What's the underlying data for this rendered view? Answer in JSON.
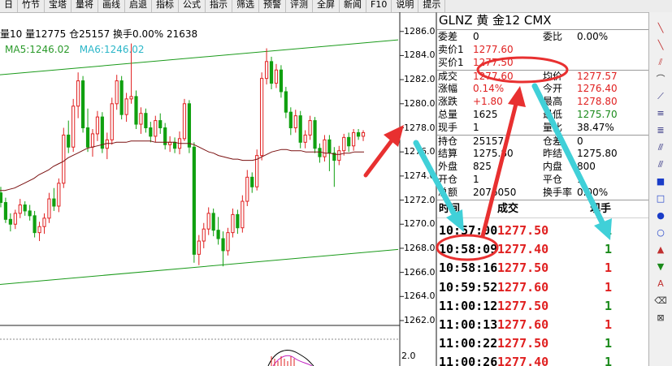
{
  "menubar": {
    "items": [
      "日",
      "竹节",
      "宝塔",
      "量将",
      "画线",
      "启退",
      "指标",
      "公式",
      "指示",
      "筛选",
      "预警",
      "评测",
      "全屏",
      "新闻",
      "F10",
      "说明",
      "提示"
    ]
  },
  "chart": {
    "info": "量10 量12775 仓25157 换手0.00% 21638",
    "ma5": "MA5:1246.02",
    "ma6": "MA6:1246.02",
    "bottom_axis_label": "2.0"
  },
  "chart_data": {
    "type": "candlestick",
    "y_ticks": [
      1262,
      1264,
      1266,
      1268,
      1270,
      1272,
      1274,
      1276,
      1278,
      1280,
      1282,
      1284,
      1286
    ],
    "y_tick_labels": [
      "1262.0",
      "1264.0",
      "1266.0",
      "1268.0",
      "1270.0",
      "1272.0",
      "1274.0",
      "1276.0",
      "1278.0",
      "1280.0",
      "1282.0",
      "1284.0",
      "1286.0"
    ],
    "ylim": [
      1262,
      1287.6
    ],
    "candles": [
      [
        1272.6,
        1273.1,
        1271.4,
        1271.8
      ],
      [
        1271.8,
        1272.2,
        1270.1,
        1270.4
      ],
      [
        1270.4,
        1270.9,
        1269.4,
        1270.0
      ],
      [
        1270.0,
        1271.2,
        1269.6,
        1270.9
      ],
      [
        1270.9,
        1272.1,
        1270.5,
        1271.6
      ],
      [
        1271.6,
        1271.9,
        1270.7,
        1271.1
      ],
      [
        1271.1,
        1271.6,
        1270.3,
        1270.7
      ],
      [
        1270.7,
        1271.1,
        1268.9,
        1269.3
      ],
      [
        1269.3,
        1270.2,
        1268.6,
        1269.8
      ],
      [
        1269.8,
        1270.9,
        1269.2,
        1270.5
      ],
      [
        1270.5,
        1272.6,
        1270.1,
        1272.1
      ],
      [
        1272.1,
        1273.0,
        1271.1,
        1271.5
      ],
      [
        1271.5,
        1273.8,
        1271.0,
        1273.4
      ],
      [
        1273.4,
        1278.0,
        1273.0,
        1277.4
      ],
      [
        1277.4,
        1278.6,
        1275.9,
        1276.4
      ],
      [
        1276.4,
        1280.4,
        1276.0,
        1279.8
      ],
      [
        1279.8,
        1282.6,
        1278.8,
        1281.9
      ],
      [
        1281.9,
        1282.3,
        1277.6,
        1278.0
      ],
      [
        1278.0,
        1279.6,
        1276.0,
        1276.4
      ],
      [
        1276.4,
        1277.9,
        1275.6,
        1277.5
      ],
      [
        1277.5,
        1279.4,
        1276.9,
        1278.9
      ],
      [
        1278.9,
        1279.3,
        1275.9,
        1276.3
      ],
      [
        1276.3,
        1277.6,
        1275.4,
        1277.0
      ],
      [
        1277.0,
        1280.5,
        1276.6,
        1280.0
      ],
      [
        1280.0,
        1282.4,
        1279.5,
        1281.9
      ],
      [
        1281.9,
        1282.3,
        1278.7,
        1279.1
      ],
      [
        1279.1,
        1280.9,
        1278.5,
        1280.4
      ],
      [
        1280.4,
        1285.0,
        1280.0,
        1280.6
      ],
      [
        1280.6,
        1281.1,
        1277.9,
        1278.3
      ],
      [
        1278.3,
        1279.7,
        1277.5,
        1279.2
      ],
      [
        1279.2,
        1279.6,
        1277.6,
        1278.0
      ],
      [
        1278.0,
        1278.5,
        1276.8,
        1277.3
      ],
      [
        1277.3,
        1279.0,
        1276.8,
        1278.6
      ],
      [
        1278.6,
        1279.2,
        1277.5,
        1278.0
      ],
      [
        1278.0,
        1278.4,
        1276.2,
        1276.6
      ],
      [
        1276.6,
        1277.3,
        1276.0,
        1276.8
      ],
      [
        1276.8,
        1277.2,
        1275.9,
        1276.3
      ],
      [
        1276.3,
        1277.7,
        1275.8,
        1277.1
      ],
      [
        1277.1,
        1280.4,
        1276.9,
        1280.0
      ],
      [
        1280.0,
        1280.3,
        1275.9,
        1276.4
      ],
      [
        1276.4,
        1276.8,
        1266.8,
        1267.5
      ],
      [
        1267.5,
        1269.1,
        1266.6,
        1268.6
      ],
      [
        1268.6,
        1270.1,
        1268.0,
        1269.6
      ],
      [
        1269.6,
        1271.4,
        1269.1,
        1270.9
      ],
      [
        1270.9,
        1271.3,
        1269.0,
        1269.5
      ],
      [
        1269.5,
        1270.6,
        1268.3,
        1268.8
      ],
      [
        1268.8,
        1269.4,
        1266.5,
        1267.8
      ],
      [
        1267.8,
        1269.7,
        1267.4,
        1269.3
      ],
      [
        1269.3,
        1271.3,
        1268.9,
        1270.8
      ],
      [
        1270.8,
        1271.2,
        1269.2,
        1269.7
      ],
      [
        1269.7,
        1272.4,
        1269.3,
        1271.9
      ],
      [
        1271.9,
        1274.5,
        1271.5,
        1273.9
      ],
      [
        1273.9,
        1274.3,
        1272.6,
        1273.1
      ],
      [
        1273.1,
        1276.2,
        1272.8,
        1275.7
      ],
      [
        1275.7,
        1282.6,
        1275.3,
        1282.1
      ],
      [
        1282.1,
        1284.6,
        1281.6,
        1283.5
      ],
      [
        1283.5,
        1283.9,
        1281.2,
        1281.7
      ],
      [
        1281.7,
        1283.3,
        1281.3,
        1282.8
      ],
      [
        1282.8,
        1283.2,
        1280.5,
        1281.0
      ],
      [
        1281.0,
        1281.4,
        1278.8,
        1279.3
      ],
      [
        1279.3,
        1279.7,
        1277.4,
        1278.0
      ],
      [
        1278.0,
        1279.5,
        1277.6,
        1279.0
      ],
      [
        1279.0,
        1279.4,
        1276.3,
        1276.8
      ],
      [
        1276.8,
        1277.8,
        1276.3,
        1277.4
      ],
      [
        1277.4,
        1279.0,
        1277.0,
        1278.6
      ],
      [
        1278.6,
        1278.9,
        1275.9,
        1276.3
      ],
      [
        1276.3,
        1276.7,
        1275.1,
        1275.6
      ],
      [
        1275.6,
        1277.4,
        1275.2,
        1277.0
      ],
      [
        1277.0,
        1277.4,
        1274.4,
        1275.9
      ],
      [
        1275.9,
        1276.4,
        1273.1,
        1275.3
      ],
      [
        1275.3,
        1276.5,
        1274.9,
        1276.1
      ],
      [
        1276.1,
        1277.5,
        1275.7,
        1277.2
      ],
      [
        1277.2,
        1277.6,
        1276.0,
        1276.5
      ],
      [
        1276.5,
        1277.9,
        1276.1,
        1277.6
      ],
      [
        1277.6,
        1277.9,
        1277.0,
        1277.3
      ],
      [
        1277.3,
        1277.8,
        1276.9,
        1277.6
      ]
    ],
    "channel_upper": [
      [
        0,
        1282.4
      ],
      [
        490,
        1285.3
      ]
    ],
    "channel_lower": [
      [
        0,
        1265.0
      ],
      [
        490,
        1267.9
      ]
    ],
    "ma_series": [
      1272.8,
      1272.8,
      1272.9,
      1273.0,
      1273.2,
      1273.4,
      1273.6,
      1273.8,
      1274.1,
      1274.3,
      1274.5,
      1274.8,
      1275.0,
      1275.2,
      1275.5,
      1275.7,
      1275.9,
      1276.1,
      1276.3,
      1276.4,
      1276.5,
      1276.6,
      1276.7,
      1276.7,
      1276.8,
      1276.8,
      1276.8,
      1276.9,
      1276.9,
      1276.9,
      1276.9,
      1276.9,
      1276.8,
      1276.8,
      1276.8,
      1276.8,
      1276.8,
      1276.7,
      1276.7,
      1276.7,
      1276.6,
      1276.4,
      1276.2,
      1276.0,
      1275.9,
      1275.7,
      1275.6,
      1275.5,
      1275.4,
      1275.4,
      1275.3,
      1275.3,
      1275.3,
      1275.4,
      1275.6,
      1275.8,
      1276.0,
      1276.1,
      1276.2,
      1276.2,
      1276.1,
      1276.1,
      1276.1,
      1276.0,
      1276.0,
      1276.0,
      1276.0,
      1275.9,
      1275.9,
      1275.8,
      1275.8,
      1275.9,
      1275.9,
      1276.0,
      1276.0,
      1276.0
    ]
  },
  "quote": {
    "header": "GLNZ  黄  金12  CMX",
    "rows": [
      {
        "l1": "委差",
        "v1": "0",
        "c1": "",
        "l2": "委比",
        "v2": "0.00%",
        "c2": ""
      },
      {
        "l1": "卖价1",
        "v1": "1277.60",
        "c1": "red",
        "l2": "",
        "v2": "",
        "c2": ""
      },
      {
        "l1": "买价1",
        "v1": "1277.50",
        "c1": "red",
        "l2": "",
        "v2": "",
        "c2": ""
      },
      {
        "l1": "成交",
        "v1": "1277.60",
        "c1": "red",
        "l2": "均价",
        "v2": "1277.57",
        "c2": "red"
      },
      {
        "l1": "涨幅",
        "v1": "0.14%",
        "c1": "red",
        "l2": "今开",
        "v2": "1276.40",
        "c2": "red"
      },
      {
        "l1": "涨跌",
        "v1": "+1.80",
        "c1": "red",
        "l2": "最高",
        "v2": "1278.80",
        "c2": "red"
      },
      {
        "l1": "总量",
        "v1": "1625",
        "c1": "",
        "l2": "最低",
        "v2": "1275.70",
        "c2": "green"
      },
      {
        "l1": "现手",
        "v1": "1",
        "c1": "",
        "l2": "量比",
        "v2": "38.47%",
        "c2": ""
      },
      {
        "l1": "持仓",
        "v1": "25157",
        "c1": "",
        "l2": "仓差",
        "v2": "0",
        "c2": ""
      },
      {
        "l1": "结算",
        "v1": "1275.80",
        "c1": "",
        "l2": "昨结",
        "v2": "1275.80",
        "c2": ""
      },
      {
        "l1": "外盘",
        "v1": "825",
        "c1": "",
        "l2": "内盘",
        "v2": "800",
        "c2": ""
      },
      {
        "l1": "开仓",
        "v1": "1",
        "c1": "",
        "l2": "平仓",
        "v2": "1",
        "c2": ""
      },
      {
        "l1": "总额",
        "v1": "2076050",
        "c1": "",
        "l2": "换手率",
        "v2": "0.00%",
        "c2": ""
      }
    ]
  },
  "ticks": {
    "headers": [
      "时间",
      "成交",
      "现手"
    ],
    "rows": [
      {
        "time": "10:57:00",
        "price": "1277.50",
        "vol": "1",
        "vc": "green"
      },
      {
        "time": "10:58:09",
        "price": "1277.40",
        "vol": "1",
        "vc": "green"
      },
      {
        "time": "10:58:16",
        "price": "1277.50",
        "vol": "1",
        "vc": "red"
      },
      {
        "time": "10:59:52",
        "price": "1277.60",
        "vol": "1",
        "vc": "red"
      },
      {
        "time": "11:00:12",
        "price": "1277.50",
        "vol": "1",
        "vc": "green"
      },
      {
        "time": "11:00:13",
        "price": "1277.60",
        "vol": "1",
        "vc": "red"
      },
      {
        "time": "11:00:22",
        "price": "1277.50",
        "vol": "1",
        "vc": "green"
      },
      {
        "time": "11:00:26",
        "price": "1277.40",
        "vol": "1",
        "vc": "green"
      }
    ]
  },
  "toolbar": {
    "icons": [
      "diagonal-line-icon",
      "diagonal-line-icon",
      "parallel-lines-icon",
      "arc-icon",
      "fan-icon",
      "fibonacci-icon",
      "fibonacci-icon",
      "channel-icon",
      "channel-icon",
      "rectangle-icon",
      "rectangle-icon",
      "ellipse-icon",
      "ellipse-icon",
      "up-arrow-icon",
      "down-arrow-icon",
      "text-icon",
      "eraser-icon",
      "lock-icon"
    ],
    "glyphs": [
      "╲",
      "╲",
      "⫽",
      "⌒",
      "⟋",
      "≡",
      "≣",
      "⫻",
      "⫻",
      "■",
      "□",
      "●",
      "○",
      "▲",
      "▼",
      "A",
      "⌫",
      "⊠"
    ],
    "colors": [
      "#c03030",
      "#c03030",
      "#c03030",
      "#303030",
      "#303080",
      "#303080",
      "#303080",
      "#303080",
      "#303080",
      "#1a3cc8",
      "#1a3cc8",
      "#1a3cc8",
      "#1a3cc8",
      "#c03030",
      "#1a8a1a",
      "#c03030",
      "#303030",
      "#303030"
    ]
  },
  "colors": {
    "up": "#e02020",
    "down": "#10a010",
    "channel": "#1a9a1a",
    "ma": "#7a1010",
    "annotation_red": "#e83030",
    "annotation_cyan": "#40d0d8"
  }
}
